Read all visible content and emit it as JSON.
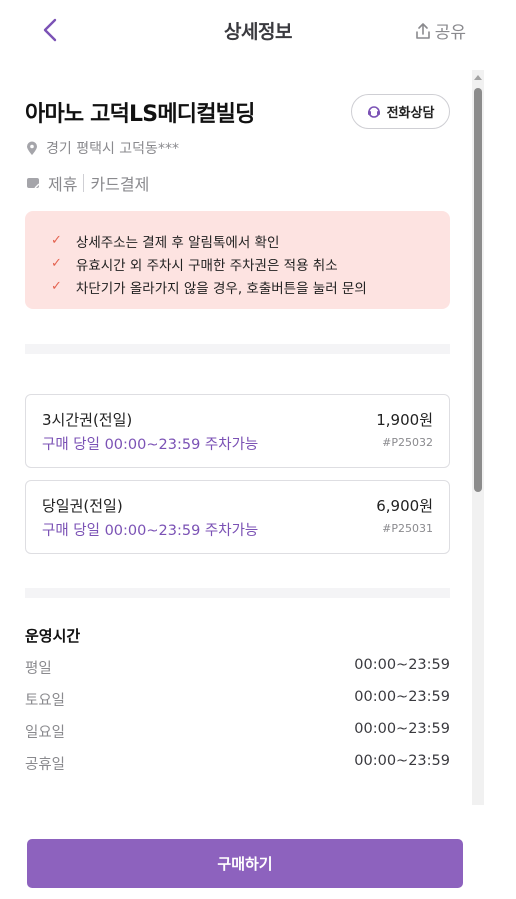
{
  "header": {
    "title": "상세정보",
    "share_label": "공유"
  },
  "place": {
    "name": "아마노 고덕LS메디컬빌딩",
    "call_label": "전화상담",
    "address": "경기 평택시 고덕동***",
    "tags": [
      "제휴",
      "카드결제"
    ]
  },
  "notice": {
    "items": [
      "상세주소는 결제 후 알림톡에서 확인",
      "유효시간 외 주차시 구매한 주차권은 적용 취소",
      "차단기가 올라가지 않을 경우, 호출버튼을 눌러 문의"
    ]
  },
  "tickets": [
    {
      "name": "3시간권(전일)",
      "price": "1,900원",
      "availability": "구매 당일 00:00~23:59 주차가능",
      "code": "#P25032"
    },
    {
      "name": "당일권(전일)",
      "price": "6,900원",
      "availability": "구매 당일 00:00~23:59 주차가능",
      "code": "#P25031"
    }
  ],
  "hours": {
    "title": "운영시간",
    "rows": [
      {
        "label": "평일",
        "value": "00:00~23:59"
      },
      {
        "label": "토요일",
        "value": "00:00~23:59"
      },
      {
        "label": "일요일",
        "value": "00:00~23:59"
      },
      {
        "label": "공휴일",
        "value": "00:00~23:59"
      }
    ]
  },
  "footer": {
    "buy_label": "구매하기"
  },
  "colors": {
    "accent": "#8d62be",
    "notice_bg": "#fde3e1",
    "check": "#e46350"
  }
}
